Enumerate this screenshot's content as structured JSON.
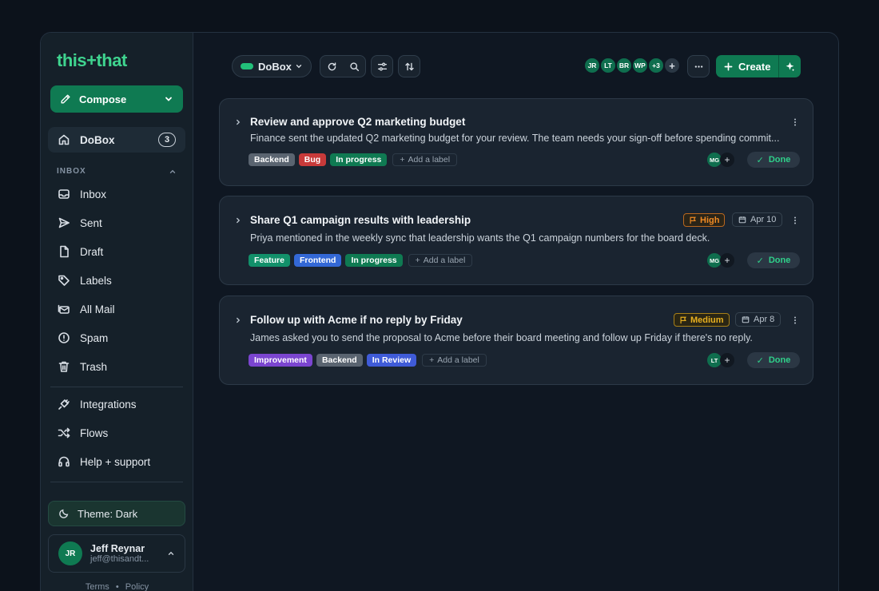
{
  "app": {
    "logo": "this+that"
  },
  "sidebar": {
    "compose_label": "Compose",
    "dobox": {
      "label": "DoBox",
      "count": "3"
    },
    "section_title": "INBOX",
    "items": [
      {
        "label": "Inbox",
        "icon": "inbox-icon"
      },
      {
        "label": "Sent",
        "icon": "send-icon"
      },
      {
        "label": "Draft",
        "icon": "file-icon"
      },
      {
        "label": "Labels",
        "icon": "tag-icon"
      },
      {
        "label": "All Mail",
        "icon": "mail-stack-icon"
      },
      {
        "label": "Spam",
        "icon": "alert-circle-icon"
      },
      {
        "label": "Trash",
        "icon": "trash-icon"
      }
    ],
    "tools": [
      {
        "label": "Integrations",
        "icon": "plug-icon"
      },
      {
        "label": "Flows",
        "icon": "shuffle-icon"
      },
      {
        "label": "Help + support",
        "icon": "headset-icon"
      }
    ],
    "theme_label": "Theme: Dark",
    "user": {
      "initials": "JR",
      "name": "Jeff Reynar",
      "email": "jeff@thisandt..."
    },
    "footer": {
      "terms": "Terms",
      "sep": "•",
      "policy": "Policy"
    }
  },
  "toolbar": {
    "view_label": "DoBox",
    "avatars": [
      "JR",
      "LT",
      "BR",
      "WP",
      "+3"
    ],
    "create_label": "Create"
  },
  "tasks": [
    {
      "title": "Review and approve Q2 marketing budget",
      "description": "Finance sent the updated Q2 marketing budget for your review. The team needs your sign-off before spending commit...",
      "labels": [
        "Backend",
        "Bug",
        "In progress"
      ],
      "add_label": "Add a label",
      "assignee": "MG",
      "done_label": "Done"
    },
    {
      "title": "Share Q1 campaign results with leadership",
      "description": "Priya mentioned in the weekly sync that leadership wants the Q1 campaign numbers for the board deck.",
      "priority": "High",
      "date": "Apr 10",
      "labels": [
        "Feature",
        "Frontend",
        "In progress"
      ],
      "add_label": "Add a label",
      "assignee": "MG",
      "done_label": "Done"
    },
    {
      "title": "Follow up with Acme if no reply by Friday",
      "description": "James asked you to send the proposal to Acme before their board meeting and follow up Friday if there's no reply.",
      "priority": "Medium",
      "date": "Apr 8",
      "labels": [
        "Improvement",
        "Backend",
        "In Review"
      ],
      "add_label": "Add a label",
      "assignee": "LT",
      "done_label": "Done"
    }
  ],
  "colors": {
    "accent": "#0f7a52",
    "brand_text": "#3fd48f",
    "tag_backend": "#5a6470",
    "tag_bug": "#c83a3a",
    "tag_in_progress": "#0f7a52",
    "tag_feature": "#12906a",
    "tag_frontend": "#3368d6",
    "tag_improvement": "#7b45d0",
    "tag_in_review": "#3f5bd8",
    "priority_high": "#f08a24",
    "priority_medium": "#e8b020"
  }
}
